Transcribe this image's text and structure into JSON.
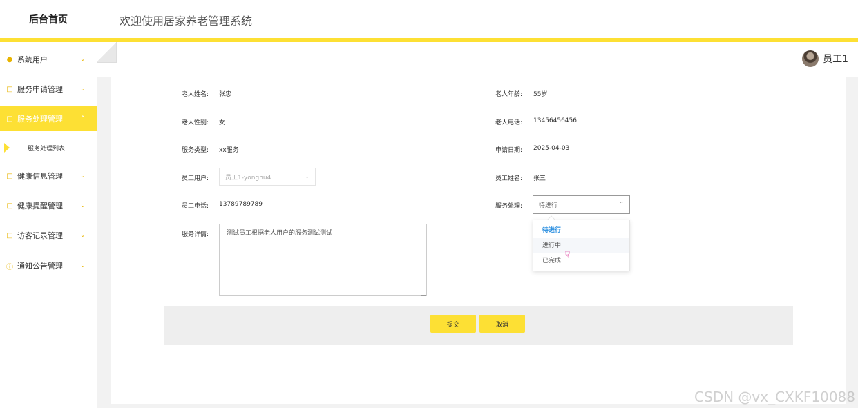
{
  "header": {
    "logo": "后台首页",
    "welcome": "欢迎使用居家养老管理系统"
  },
  "sidebar": {
    "items": [
      {
        "label": "系统用户",
        "icon": "user-icon"
      },
      {
        "label": "服务申请管理",
        "icon": "edit-icon"
      },
      {
        "label": "服务处理管理",
        "icon": "edit-icon",
        "active": true
      },
      {
        "label": "健康信息管理",
        "icon": "edit-icon"
      },
      {
        "label": "健康提醒管理",
        "icon": "edit-icon"
      },
      {
        "label": "访客记录管理",
        "icon": "edit-icon"
      },
      {
        "label": "通知公告管理",
        "icon": "info-icon"
      }
    ],
    "sub_item": "服务处理列表"
  },
  "user": {
    "name": "员工1"
  },
  "form": {
    "elder_name_label": "老人姓名:",
    "elder_name": "张忠",
    "elder_age_label": "老人年龄:",
    "elder_age": "55岁",
    "elder_gender_label": "老人性别:",
    "elder_gender": "女",
    "elder_phone_label": "老人电话:",
    "elder_phone": "13456456456",
    "service_type_label": "服务类型:",
    "service_type": "xx服务",
    "apply_date_label": "申请日期:",
    "apply_date": "2025-04-03",
    "staff_user_label": "员工用户:",
    "staff_user": "员工1-yonghu4",
    "staff_name_label": "员工姓名:",
    "staff_name": "张三",
    "staff_phone_label": "员工电话:",
    "staff_phone": "13789789789",
    "service_process_label": "服务处理:",
    "service_process_placeholder": "待进行",
    "service_detail_label": "服务详情:",
    "service_detail": "测试员工根据老人用户的服务测试测试"
  },
  "dropdown": {
    "options": [
      "待进行",
      "进行中",
      "已完成"
    ]
  },
  "actions": {
    "submit": "提交",
    "cancel": "取消"
  },
  "watermark": "CSDN @vx_CXKF10088",
  "colors": {
    "accent": "#fde034",
    "selected_option": "#2b8fe0"
  }
}
